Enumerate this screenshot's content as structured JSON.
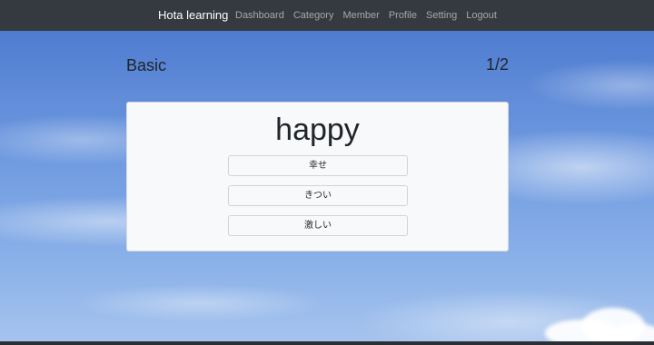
{
  "navbar": {
    "brand": "Hota learning",
    "links": [
      "Dashboard",
      "Category",
      "Member",
      "Profile",
      "Setting",
      "Logout"
    ]
  },
  "lesson": {
    "title": "Basic",
    "progress": "1/2"
  },
  "quiz": {
    "word": "happy",
    "choices": [
      "幸せ",
      "きつい",
      "激しい"
    ]
  },
  "colors": {
    "navbar_bg": "#343a40",
    "card_bg": "#f8f9fa",
    "sky": "#6f9ae0"
  }
}
